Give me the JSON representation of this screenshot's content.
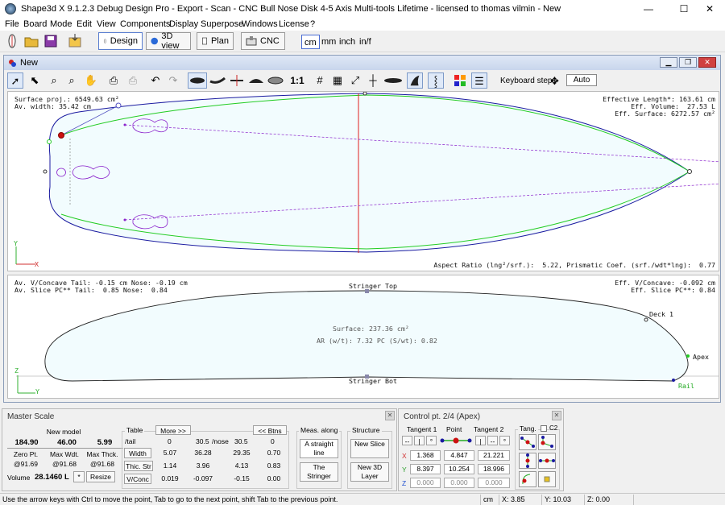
{
  "window": {
    "title": "Shape3d X 9.1.2.3 Debug Design Pro - Export - Scan - CNC Bull Nose Disk 4-5 Axis Multi-tools Lifetime - licensed to thomas vilmin - New",
    "controls": {
      "minimize": "—",
      "maximize": "☐",
      "close": "✕"
    }
  },
  "menu": [
    "File",
    "Board",
    "Mode",
    "Edit",
    "View",
    "Components",
    "Display",
    "Superpose",
    "Windows",
    "License",
    "?"
  ],
  "toolbar": {
    "modes": [
      "Design",
      "3D view",
      "Plan",
      "CNC"
    ],
    "units": [
      "cm",
      "mm",
      "inch",
      "in/f"
    ],
    "active_unit": "cm"
  },
  "document": {
    "title": "New",
    "tools": {
      "scale_label": "1:1",
      "keyboard_steps_label": "Keyboard steps",
      "auto_label": "Auto"
    }
  },
  "plan_view": {
    "top_left": [
      "Surface proj.: 6549.63 cm²",
      "Av. width: 35.42 cm"
    ],
    "top_right": [
      "Effective Length*: 163.61 cm",
      "Eff. Volume:  27.53 L",
      "Eff. Surface: 6272.57 cm²"
    ],
    "bottom_right": "Aspect Ratio (lng²/srf.):  5.22, Prismatic Coef. (srf./wdt*lng):  0.77",
    "axis": {
      "x": "X",
      "y": "Y"
    }
  },
  "profile_view": {
    "top_left": [
      "Av. V/Concave Tail: -0.15 cm Nose: -0.19 cm",
      "Av. Slice PC** Tail:  0.85 Nose:  0.84"
    ],
    "top_right": [
      "Eff. V/Concave: -0.092 cm",
      "Eff. Slice PC**: 0.84"
    ],
    "labels": {
      "stringer_top": "Stringer Top",
      "stringer_bot": "Stringer Bot",
      "deck": "Deck 1",
      "apex": "Apex",
      "rail": "Rail"
    },
    "center": [
      "Surface: 237.36 cm²",
      "AR (w/t): 7.32 PC (S/wt): 0.82"
    ],
    "axis": {
      "x": "Y",
      "y": "Z"
    }
  },
  "master_scale": {
    "title": "Master Scale",
    "new_model_label": "New model",
    "dims": [
      "184.90",
      "46.00",
      "5.99"
    ],
    "dim_labels": [
      "Zero Pt.",
      "Max Wdt.",
      "Max Thck."
    ],
    "at_values": [
      "@91.69",
      "@91.68",
      "@91.68"
    ],
    "volume_label": "Volume",
    "volume_value": "28.1460 L",
    "star_label": "*",
    "resize_label": "Resize",
    "table": {
      "title": "Table",
      "more_label": "More >>",
      "btns_label": "<< Btns",
      "headers": [
        "/tail",
        "0",
        "30.5",
        "/nose",
        "30.5",
        "0"
      ],
      "rows": [
        {
          "label": "Width",
          "values": [
            "5.07",
            "36.28",
            "29.35",
            "0.70"
          ]
        },
        {
          "label": "Thic. Str",
          "values": [
            "1.14",
            "3.96",
            "4.13",
            "0.83"
          ]
        },
        {
          "label": "V/Conc",
          "values": [
            "0.019",
            "-0.097",
            "-0.15",
            "0.00"
          ]
        }
      ]
    },
    "meas": {
      "title": "Meas. along",
      "options": [
        "A straight line",
        "The Stringer"
      ]
    },
    "structure": {
      "title": "Structure",
      "options": [
        "New Slice",
        "New 3D Layer"
      ]
    }
  },
  "control_point": {
    "title": "Control pt. 2/4 (Apex)",
    "headers": [
      "Tangent 1",
      "Point",
      "Tangent 2"
    ],
    "tang_label": "Tang.",
    "c2_label": "C2",
    "rows": [
      {
        "axis": "X",
        "values": [
          "1.368",
          "4.847",
          "21.221"
        ]
      },
      {
        "axis": "Y",
        "values": [
          "8.397",
          "10.254",
          "18.996"
        ]
      },
      {
        "axis": "Z",
        "values": [
          "0.000",
          "0.000",
          "0.000"
        ]
      }
    ],
    "mode_buttons": [
      "--",
      "|",
      "°"
    ]
  },
  "status": {
    "message": "Use the arrow keys with Ctrl to move the point, Tab to go to the next point, shift Tab to the previous point.",
    "unit": "cm",
    "x": "X: 3.85",
    "y": "Y: 10.03",
    "z": "Z: 0.00"
  },
  "colors": {
    "outline": "#1a1aa0",
    "curve": "#22cc22",
    "stringer": "#e02020",
    "selection": "#cc1111",
    "accent": "#4a6cd4"
  }
}
